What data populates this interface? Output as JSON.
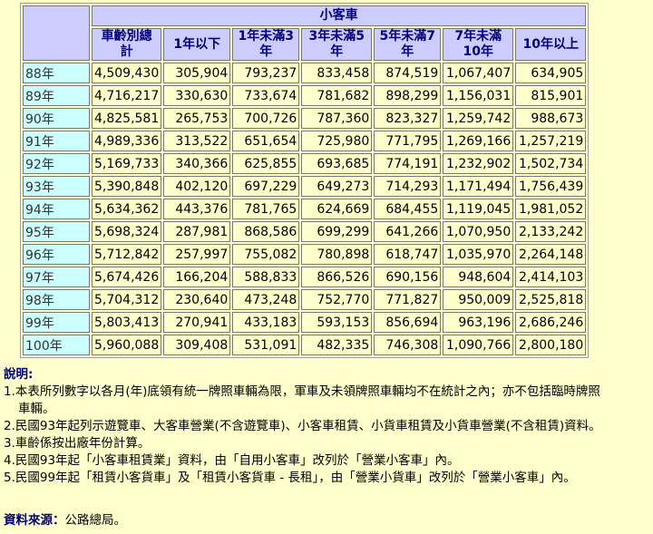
{
  "table": {
    "group_header": "小客車",
    "columns": [
      "車齡別總\n計",
      "1年以下",
      "1年未滿3\n年",
      "3年未滿5\n年",
      "5年未滿7\n年",
      "7年未滿\n10年",
      "10年以上"
    ],
    "rows": [
      {
        "year": "88年",
        "values": [
          "4,509,430",
          "305,904",
          "793,237",
          "833,458",
          "874,519",
          "1,067,407",
          "634,905"
        ]
      },
      {
        "year": "89年",
        "values": [
          "4,716,217",
          "330,630",
          "733,674",
          "781,682",
          "898,299",
          "1,156,031",
          "815,901"
        ]
      },
      {
        "year": "90年",
        "values": [
          "4,825,581",
          "265,753",
          "700,726",
          "787,360",
          "823,327",
          "1,259,742",
          "988,673"
        ]
      },
      {
        "year": "91年",
        "values": [
          "4,989,336",
          "313,522",
          "651,654",
          "725,980",
          "771,795",
          "1,269,166",
          "1,257,219"
        ]
      },
      {
        "year": "92年",
        "values": [
          "5,169,733",
          "340,366",
          "625,855",
          "693,685",
          "774,191",
          "1,232,902",
          "1,502,734"
        ]
      },
      {
        "year": "93年",
        "values": [
          "5,390,848",
          "402,120",
          "697,229",
          "649,273",
          "714,293",
          "1,171,494",
          "1,756,439"
        ]
      },
      {
        "year": "94年",
        "values": [
          "5,634,362",
          "443,376",
          "781,765",
          "624,669",
          "684,455",
          "1,119,045",
          "1,981,052"
        ]
      },
      {
        "year": "95年",
        "values": [
          "5,698,324",
          "287,981",
          "868,586",
          "699,299",
          "641,266",
          "1,070,950",
          "2,133,242"
        ]
      },
      {
        "year": "96年",
        "values": [
          "5,712,842",
          "257,997",
          "755,082",
          "780,898",
          "618,747",
          "1,035,970",
          "2,264,148"
        ]
      },
      {
        "year": "97年",
        "values": [
          "5,674,426",
          "166,204",
          "588,833",
          "866,526",
          "690,156",
          "948,604",
          "2,414,103"
        ]
      },
      {
        "year": "98年",
        "values": [
          "5,704,312",
          "230,640",
          "473,248",
          "752,770",
          "771,827",
          "950,009",
          "2,525,818"
        ]
      },
      {
        "year": "99年",
        "values": [
          "5,803,413",
          "270,941",
          "433,183",
          "593,153",
          "856,694",
          "963,196",
          "2,686,246"
        ]
      },
      {
        "year": "100年",
        "values": [
          "5,960,088",
          "309,408",
          "531,091",
          "482,335",
          "746,308",
          "1,090,766",
          "2,800,180"
        ]
      }
    ]
  },
  "notes": {
    "title": "說明:",
    "items": [
      {
        "first": "1.本表所列數字以各月(年)底領有統一牌照車輛為限，軍車及未領牌照車輛均不在統計之內；亦不包括臨時牌照",
        "cont": "車輛。"
      },
      {
        "first": "2.民國93年起列示遊覽車、大客車營業(不含遊覽車)、小客車租賃、小貨車租賃及小貨車營業(不含租賃)資料。",
        "cont": ""
      },
      {
        "first": "3.車齡係按出廠年份計算。",
        "cont": ""
      },
      {
        "first": "4.民國93年起「小客車租賃業」資料，由「自用小客車」改列於「營業小客車」內。",
        "cont": ""
      },
      {
        "first": "5.民國99年起「租賃小客貨車」及「租賃小客貨車 - 長租」，由「營業小貨車」改列於「營業小客車」內。",
        "cont": ""
      }
    ]
  },
  "source": {
    "label": "資料來源",
    "colon": "：",
    "text": "公路總局。"
  }
}
